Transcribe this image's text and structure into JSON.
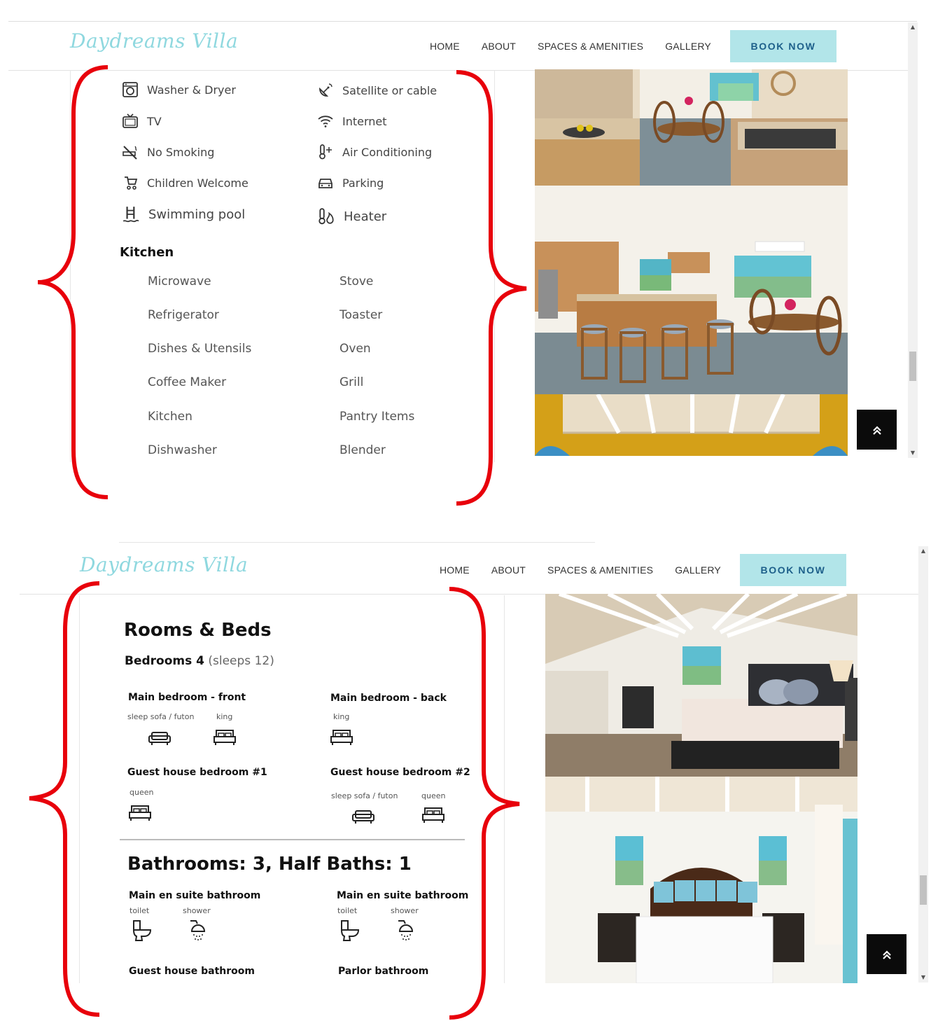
{
  "site": {
    "logo": "Daydreams Villa",
    "nav": [
      "HOME",
      "ABOUT",
      "SPACES & AMENITIES",
      "GALLERY"
    ],
    "book_now": "BOOK NOW"
  },
  "amenities": {
    "left": [
      "Washer & Dryer",
      "TV",
      "No Smoking",
      "Children Welcome",
      "Swimming pool"
    ],
    "right": [
      "Satellite or cable",
      "Internet",
      "Air Conditioning",
      "Parking",
      "Heater"
    ]
  },
  "kitchen": {
    "heading": "Kitchen",
    "left": [
      "Microwave",
      "Refrigerator",
      "Dishes & Utensils",
      "Coffee Maker",
      "Kitchen",
      "Dishwasher"
    ],
    "right": [
      "Stove",
      "Toaster",
      "Oven",
      "Grill",
      "Pantry Items",
      "Blender"
    ]
  },
  "rooms": {
    "title": "Rooms & Beds",
    "bedrooms_label": "Bedrooms 4",
    "sleeps": "(sleeps 12)",
    "list": [
      {
        "name": "Main bedroom - front",
        "beds": [
          "sleep sofa / futon",
          "king"
        ]
      },
      {
        "name": "Main bedroom - back",
        "beds": [
          "king"
        ]
      },
      {
        "name": "Guest house bedroom #1",
        "beds": [
          "queen"
        ]
      },
      {
        "name": "Guest house bedroom #2",
        "beds": [
          "sleep sofa / futon",
          "queen"
        ]
      }
    ]
  },
  "bathrooms": {
    "title": "Bathrooms: 3, Half Baths: 1",
    "list": [
      {
        "name": "Main en suite bathroom",
        "fixtures": [
          "toilet",
          "shower"
        ]
      },
      {
        "name": "Main en suite bathroom",
        "fixtures": [
          "toilet",
          "shower"
        ]
      },
      {
        "name": "Guest house bathroom",
        "fixtures": []
      },
      {
        "name": "Parlor bathroom",
        "fixtures": []
      }
    ]
  },
  "colors": {
    "accent": "#b2e5e9",
    "brace": "#e8000b",
    "logo": "#8fd8df"
  }
}
